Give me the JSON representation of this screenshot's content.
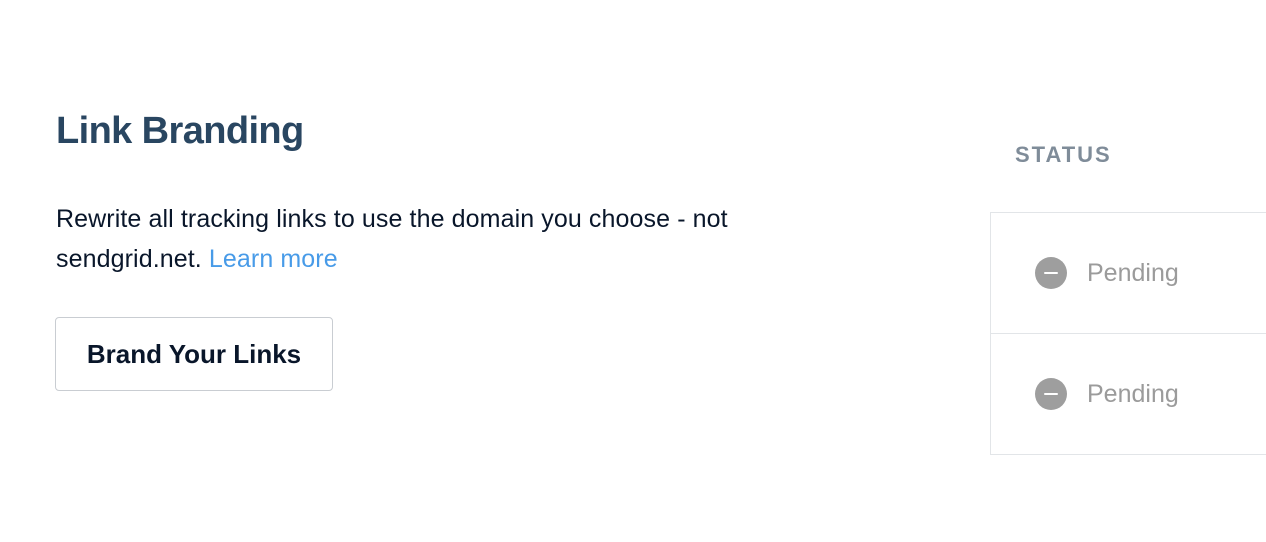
{
  "section": {
    "title": "Link Branding",
    "description": "Rewrite all tracking links to use the domain you choose - not sendgrid.net.",
    "learn_more": "Learn more",
    "button_label": "Brand Your Links"
  },
  "status": {
    "header": "STATUS",
    "rows": [
      {
        "icon": "pending-icon",
        "label": "Pending"
      },
      {
        "icon": "pending-icon",
        "label": "Pending"
      }
    ]
  },
  "colors": {
    "title": "#294661",
    "link": "#489be8",
    "pending_icon": "#9e9e9e",
    "status_header": "#7f8c99"
  }
}
